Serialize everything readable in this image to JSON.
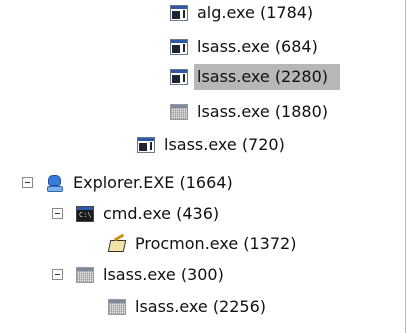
{
  "process_tree": {
    "rows": [
      {
        "label": "alg.exe (1784)",
        "icon": "window-icon"
      },
      {
        "label": "lsass.exe (684)",
        "icon": "window-icon"
      },
      {
        "label": "lsass.exe (2280)",
        "icon": "window-icon",
        "selected": true
      },
      {
        "label": "lsass.exe (1880)",
        "icon": "generic-process-icon"
      },
      {
        "label": "lsass.exe (720)",
        "icon": "window-icon"
      },
      {
        "label": "Explorer.EXE (1664)",
        "icon": "explorer-icon",
        "expanded": true
      },
      {
        "label": "cmd.exe (436)",
        "icon": "cmd-icon",
        "expanded": true
      },
      {
        "label": "Procmon.exe (1372)",
        "icon": "procmon-icon"
      },
      {
        "label": "lsass.exe (300)",
        "icon": "generic-process-icon",
        "expanded": true
      },
      {
        "label": "lsass.exe (2256)",
        "icon": "generic-process-icon"
      }
    ]
  },
  "icons": {
    "cmd_text": "C:\\"
  },
  "colors": {
    "selection": "#b7b7b7",
    "background": "#ffffff"
  }
}
